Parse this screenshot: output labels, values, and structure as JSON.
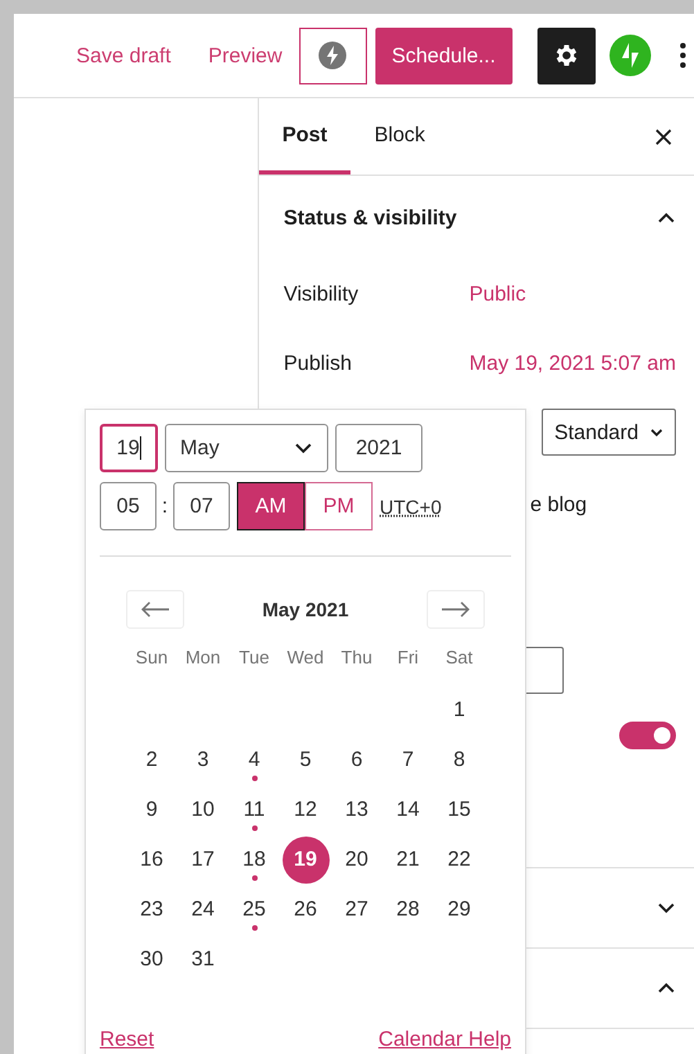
{
  "header": {
    "save_draft": "Save draft",
    "preview": "Preview",
    "schedule": "Schedule...",
    "settings_active": true
  },
  "sidebar": {
    "tabs": [
      {
        "label": "Post",
        "selected": true
      },
      {
        "label": "Block",
        "selected": false
      }
    ],
    "panels": [
      {
        "title": "Status & visibility",
        "expanded": true
      },
      {
        "expanded": false
      },
      {
        "expanded": true
      }
    ],
    "rows": [
      {
        "label": "Visibility",
        "value": "Public"
      },
      {
        "label": "Publish",
        "value": "May 19, 2021 5:07 am"
      }
    ],
    "format_select": "Standard",
    "partial_label": "e blog",
    "toggle": {
      "on": true
    }
  },
  "date_picker": {
    "day": "19",
    "month": "May",
    "year": "2021",
    "hour": "05",
    "separator": ":",
    "minute": "07",
    "meridiem": [
      {
        "label": "AM",
        "selected": true
      },
      {
        "label": "PM",
        "selected": false
      }
    ],
    "timezone": "UTC+0",
    "month_title": "May 2021",
    "weekdays": [
      "Sun",
      "Mon",
      "Tue",
      "Wed",
      "Thu",
      "Fri",
      "Sat"
    ],
    "weeks": [
      {
        "kind": "tail",
        "days": [
          {
            "day": "1",
            "selected": false,
            "has_post": false
          }
        ]
      },
      {
        "kind": "head",
        "days": [
          {
            "day": "2",
            "selected": false,
            "has_post": false
          },
          {
            "day": "3",
            "selected": false,
            "has_post": false
          },
          {
            "day": "4",
            "selected": false,
            "has_post": true
          },
          {
            "day": "5",
            "selected": false,
            "has_post": false
          },
          {
            "day": "6",
            "selected": false,
            "has_post": false
          },
          {
            "day": "7",
            "selected": false,
            "has_post": false
          },
          {
            "day": "8",
            "selected": false,
            "has_post": false
          }
        ]
      },
      {
        "kind": "head",
        "days": [
          {
            "day": "9",
            "selected": false,
            "has_post": false
          },
          {
            "day": "10",
            "selected": false,
            "has_post": false
          },
          {
            "day": "11",
            "selected": false,
            "has_post": true
          },
          {
            "day": "12",
            "selected": false,
            "has_post": false
          },
          {
            "day": "13",
            "selected": false,
            "has_post": false
          },
          {
            "day": "14",
            "selected": false,
            "has_post": false
          },
          {
            "day": "15",
            "selected": false,
            "has_post": false
          }
        ]
      },
      {
        "kind": "head",
        "days": [
          {
            "day": "16",
            "selected": false,
            "has_post": false
          },
          {
            "day": "17",
            "selected": false,
            "has_post": false
          },
          {
            "day": "18",
            "selected": false,
            "has_post": true
          },
          {
            "day": "19",
            "selected": true,
            "has_post": false
          },
          {
            "day": "20",
            "selected": false,
            "has_post": false
          },
          {
            "day": "21",
            "selected": false,
            "has_post": false
          },
          {
            "day": "22",
            "selected": false,
            "has_post": false
          }
        ]
      },
      {
        "kind": "head",
        "days": [
          {
            "day": "23",
            "selected": false,
            "has_post": false
          },
          {
            "day": "24",
            "selected": false,
            "has_post": false
          },
          {
            "day": "25",
            "selected": false,
            "has_post": true
          },
          {
            "day": "26",
            "selected": false,
            "has_post": false
          },
          {
            "day": "27",
            "selected": false,
            "has_post": false
          },
          {
            "day": "28",
            "selected": false,
            "has_post": false
          },
          {
            "day": "29",
            "selected": false,
            "has_post": false
          }
        ]
      },
      {
        "kind": "head",
        "days": [
          {
            "day": "30",
            "selected": false,
            "has_post": false
          },
          {
            "day": "31",
            "selected": false,
            "has_post": false
          }
        ]
      }
    ],
    "reset": "Reset",
    "help": "Calendar Help"
  }
}
